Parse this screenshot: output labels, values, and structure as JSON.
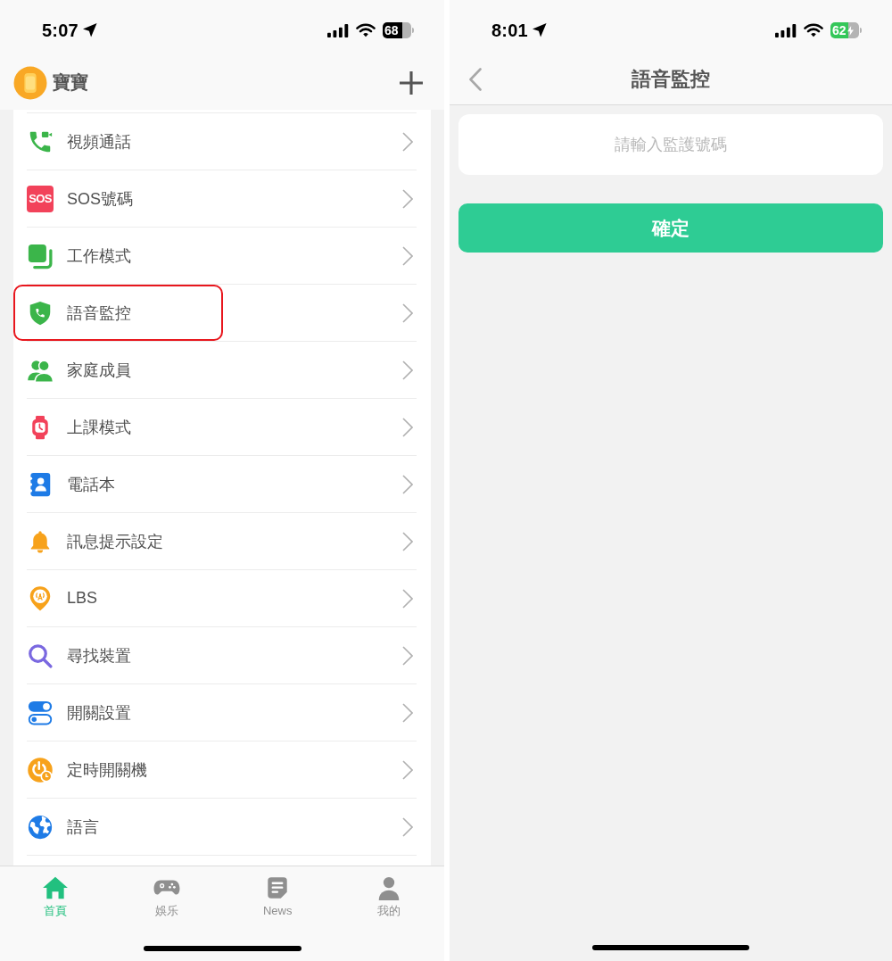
{
  "left_screen": {
    "status_bar": {
      "time": "5:07",
      "battery": "68",
      "charging": false
    },
    "header": {
      "title": "寶寶"
    },
    "menu": [
      {
        "kind": "video-call",
        "label": "視頻通話",
        "highlighted": false
      },
      {
        "kind": "sos",
        "badge": "SOS",
        "label": "SOS號碼",
        "highlighted": false
      },
      {
        "kind": "work-mode",
        "label": "工作模式",
        "highlighted": false
      },
      {
        "kind": "voice-monitor",
        "label": "語音監控",
        "highlighted": true
      },
      {
        "kind": "family",
        "label": "家庭成員",
        "highlighted": false
      },
      {
        "kind": "class-mode",
        "label": "上課模式",
        "highlighted": false
      },
      {
        "kind": "phonebook",
        "label": "電話本",
        "highlighted": false
      },
      {
        "kind": "notification",
        "label": "訊息提示設定",
        "highlighted": false
      },
      {
        "kind": "lbs",
        "label": "LBS",
        "highlighted": false
      },
      {
        "kind": "find-device",
        "label": "尋找裝置",
        "highlighted": false
      },
      {
        "kind": "switches",
        "label": "開關設置",
        "highlighted": false
      },
      {
        "kind": "scheduled-power",
        "label": "定時開關機",
        "highlighted": false
      },
      {
        "kind": "language",
        "label": "語言",
        "highlighted": false
      }
    ],
    "tab_bar": [
      {
        "kind": "home",
        "label": "首頁",
        "selected": true
      },
      {
        "kind": "games",
        "label": "娛乐",
        "selected": false
      },
      {
        "kind": "news",
        "label": "News",
        "selected": false
      },
      {
        "kind": "profile",
        "label": "我的",
        "selected": false
      }
    ]
  },
  "right_screen": {
    "status_bar": {
      "time": "8:01",
      "battery": "62",
      "charging": true
    },
    "nav_bar": {
      "title": "語音監控"
    },
    "number_field": {
      "placeholder": "請輸入監護號碼"
    },
    "confirm_button": {
      "label": "確定"
    }
  }
}
